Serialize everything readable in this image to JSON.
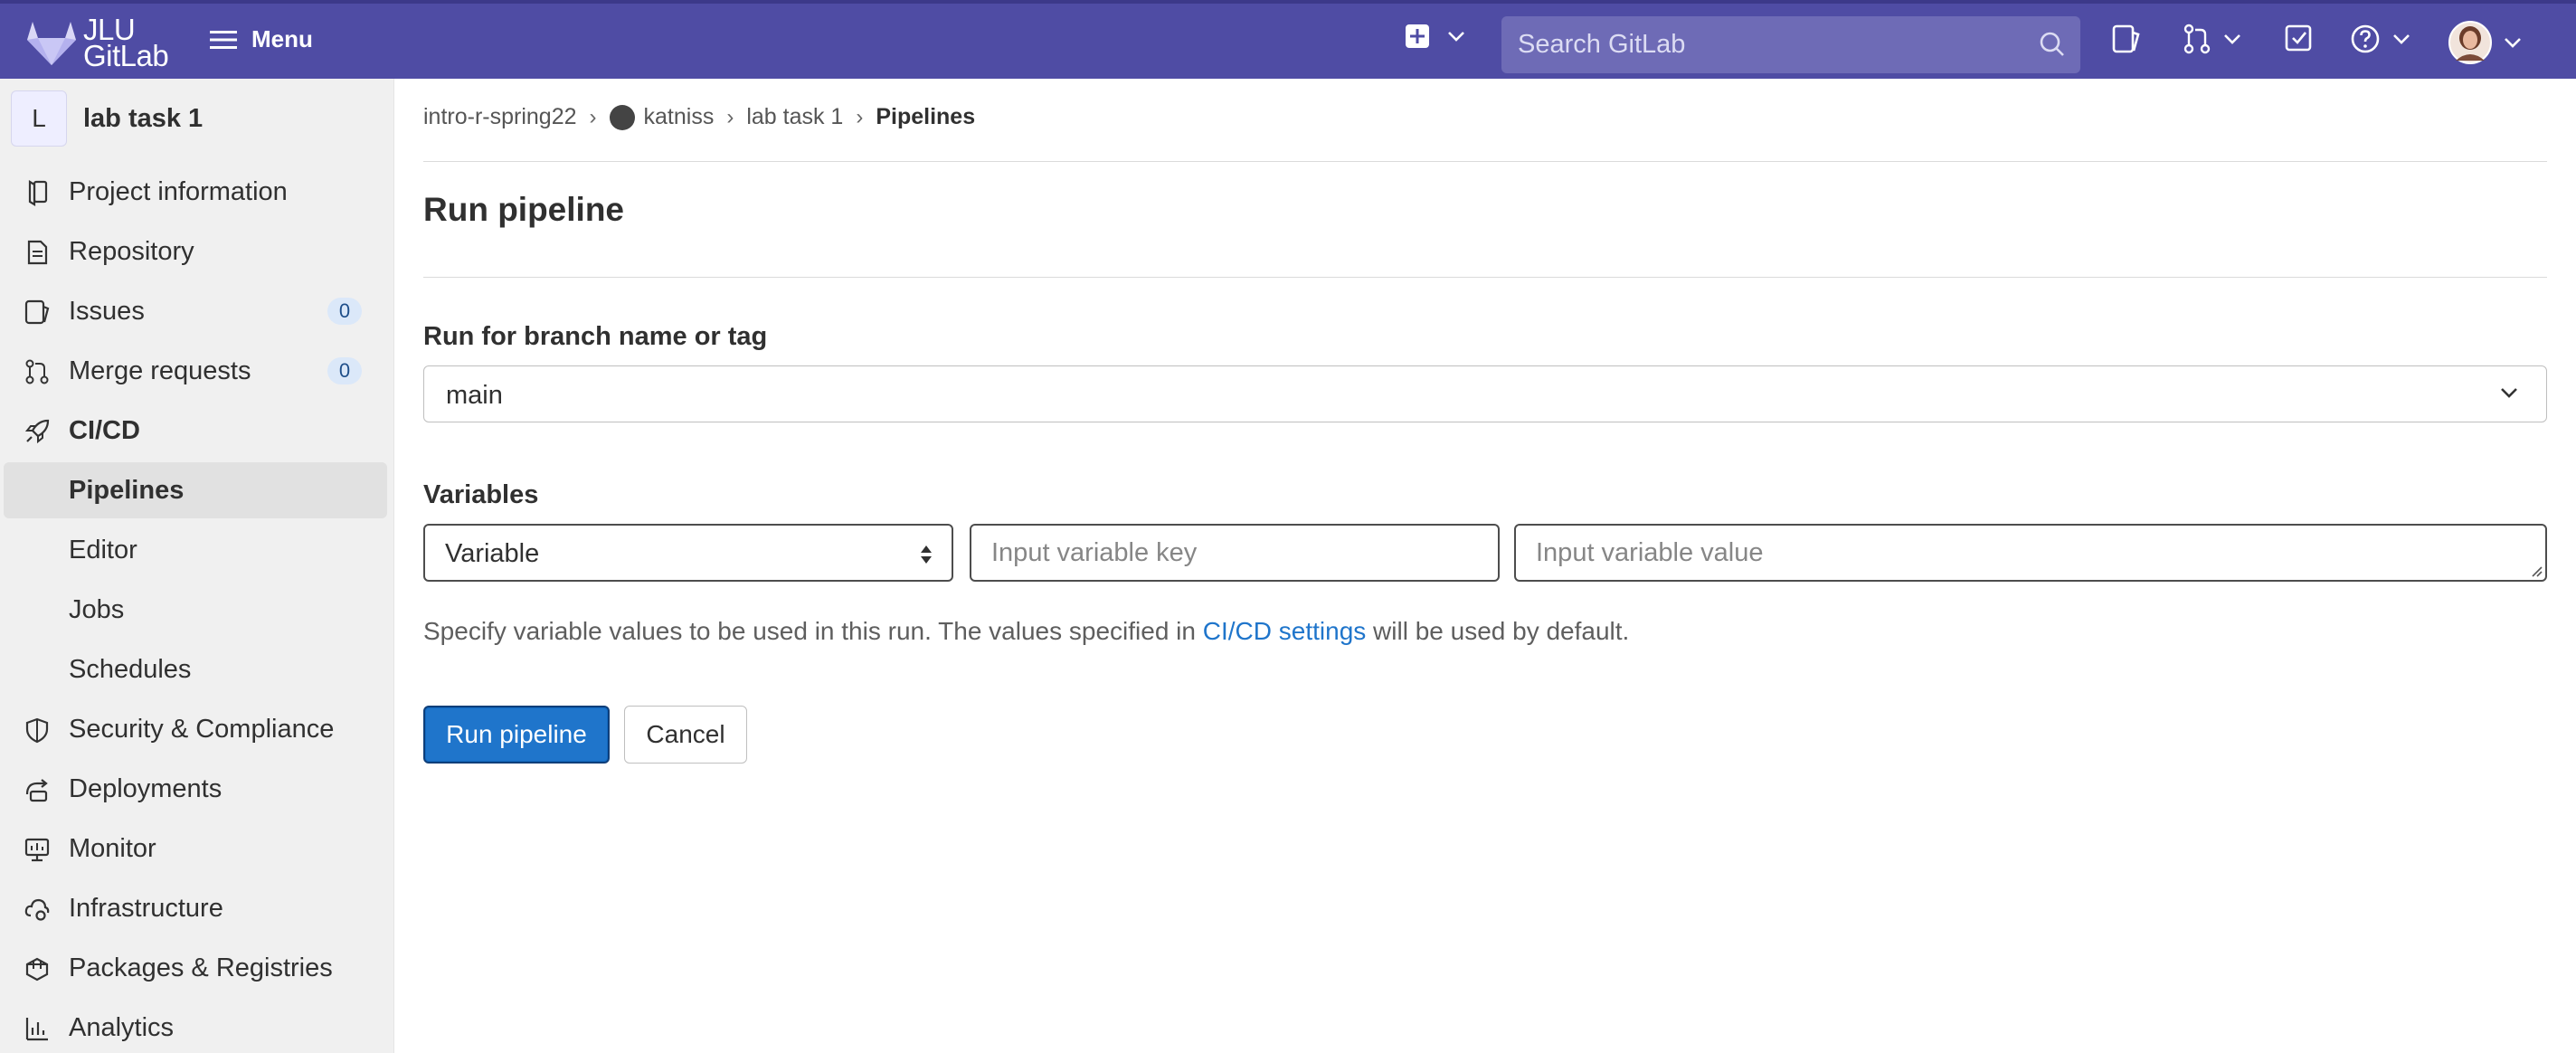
{
  "header": {
    "logo_line1": "JLU",
    "logo_line2": "GitLab",
    "menu_label": "Menu",
    "search_placeholder": "Search GitLab",
    "icons": [
      "plus-square-icon",
      "search-icon",
      "issues-icon",
      "merge-request-icon",
      "todo-icon",
      "help-icon",
      "user-avatar"
    ]
  },
  "sidebar": {
    "project_initial": "L",
    "project_name": "lab task 1",
    "items": [
      {
        "label": "Project information",
        "icon": "project-info-icon"
      },
      {
        "label": "Repository",
        "icon": "repository-icon"
      },
      {
        "label": "Issues",
        "icon": "issues-icon",
        "badge": "0"
      },
      {
        "label": "Merge requests",
        "icon": "merge-request-icon",
        "badge": "0"
      },
      {
        "label": "CI/CD",
        "icon": "rocket-icon"
      },
      {
        "label": "Pipelines"
      },
      {
        "label": "Editor"
      },
      {
        "label": "Jobs"
      },
      {
        "label": "Schedules"
      },
      {
        "label": "Security & Compliance",
        "icon": "shield-icon"
      },
      {
        "label": "Deployments",
        "icon": "deployments-icon"
      },
      {
        "label": "Monitor",
        "icon": "monitor-icon"
      },
      {
        "label": "Infrastructure",
        "icon": "cloud-gear-icon"
      },
      {
        "label": "Packages & Registries",
        "icon": "package-icon"
      },
      {
        "label": "Analytics",
        "icon": "chart-icon"
      }
    ]
  },
  "breadcrumb": [
    "intro-r-spring22",
    "katniss",
    "lab task 1",
    "Pipelines"
  ],
  "page": {
    "title": "Run pipeline",
    "branch_label": "Run for branch name or tag",
    "branch_value": "main",
    "variables_label": "Variables",
    "variable_type": "Variable",
    "key_placeholder": "Input variable key",
    "value_placeholder": "Input variable value",
    "help_before": "Specify variable values to be used in this run. The values specified in ",
    "help_link": "CI/CD settings",
    "help_after": " will be used by default.",
    "run_button": "Run pipeline",
    "cancel_button": "Cancel"
  },
  "colors": {
    "header_bg": "#4f4ca4",
    "primary": "#1f75cb",
    "link": "#1f75cb"
  }
}
